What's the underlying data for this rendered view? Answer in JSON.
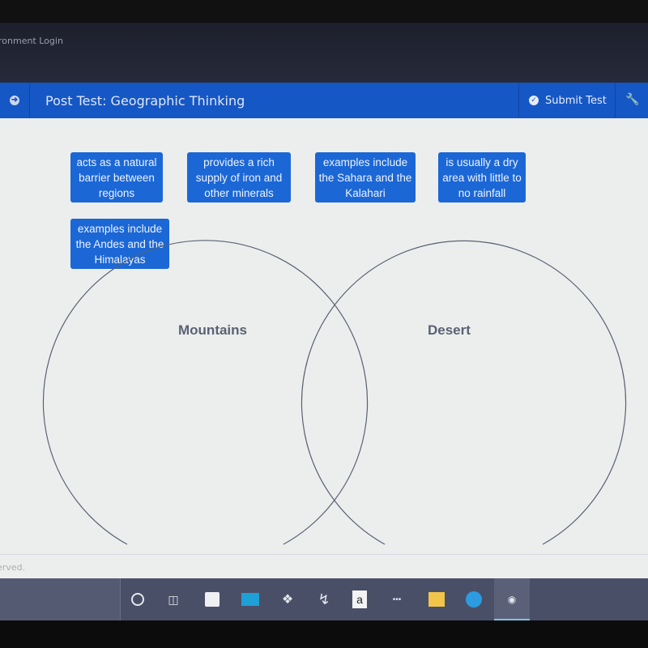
{
  "browser": {
    "tab_title": "ronment Login"
  },
  "header": {
    "title": "Post Test: Geographic Thinking",
    "submit_label": "Submit Test",
    "nav_icon": "arrow-right-circle-icon",
    "submit_icon": "check-circle-icon",
    "tool_icon": "wrench-icon",
    "colors": {
      "header_bg": "#1557c4",
      "tile_bg": "#1b67d6"
    }
  },
  "tiles": [
    {
      "text": "acts as a natural barrier between regions"
    },
    {
      "text": "provides a rich supply of iron and other minerals"
    },
    {
      "text": "examples include the Sahara and the Kalahari"
    },
    {
      "text": "is usually a dry area with little to no rainfall"
    },
    {
      "text": "examples include the Andes and the Himalayas"
    }
  ],
  "venn": {
    "left_label": "Mountains",
    "right_label": "Desert"
  },
  "footer": {
    "text": "erved."
  },
  "taskbar": {
    "icons": [
      "cortana-circle-icon",
      "task-view-icon",
      "store-icon",
      "mail-icon",
      "dropbox-icon",
      "app-bolt-icon",
      "amazon-icon",
      "dots-app-icon",
      "file-explorer-icon",
      "edge-icon",
      "media-app-icon"
    ]
  }
}
